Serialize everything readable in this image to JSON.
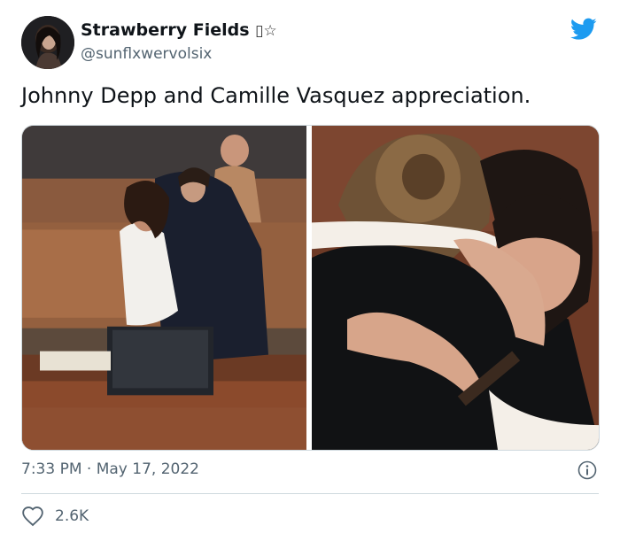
{
  "author": {
    "display_name": "Strawberry Fields",
    "badge": "▯☆",
    "handle": "@sunflxwervolsix"
  },
  "tweet": {
    "text": "Johnny Depp and Camille Vasquez appreciation.",
    "timestamp": "7:33 PM · May 17, 2022",
    "likes": "2.6K"
  },
  "colors": {
    "brand_blue": "#1d9bf0",
    "text_primary": "#0f1419",
    "text_secondary": "#536471"
  },
  "icons": [
    "avatar",
    "twitter-bird-icon",
    "info-icon",
    "heart-icon"
  ]
}
